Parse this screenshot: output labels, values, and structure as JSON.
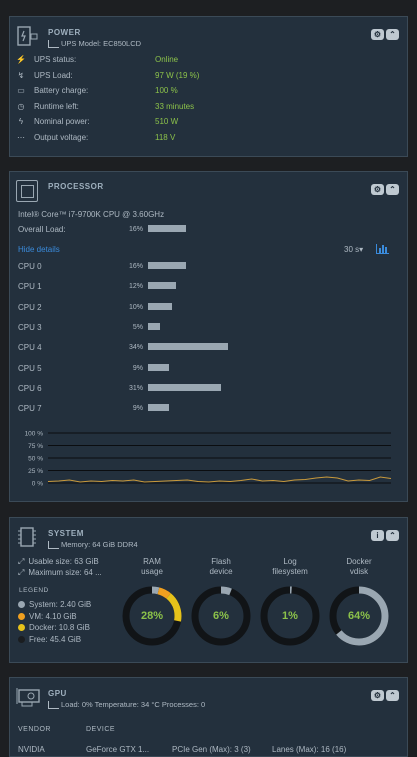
{
  "colors": {
    "bg": "#1d1f22",
    "panel": "#23303d",
    "green": "#8cc24a",
    "link": "#3a8bdc",
    "bar": "#9aa7b2",
    "orange": "#f0a020",
    "yellow": "#e6c21a"
  },
  "power": {
    "title": "POWER",
    "model": "UPS Model: EC850LCD",
    "rows": [
      {
        "icon": "plug-icon",
        "label": "UPS status:",
        "value": "Online"
      },
      {
        "icon": "load-icon",
        "label": "UPS Load:",
        "value": "97 W (19 %)"
      },
      {
        "icon": "battery-icon",
        "label": "Battery charge:",
        "value": "100 %"
      },
      {
        "icon": "clock-icon",
        "label": "Runtime left:",
        "value": "33 minutes"
      },
      {
        "icon": "bolt-icon",
        "label": "Nominal power:",
        "value": "510 W"
      },
      {
        "icon": "dots-icon",
        "label": "Output voltage:",
        "value": "118 V"
      }
    ]
  },
  "processor": {
    "title": "PROCESSOR",
    "model": "Intel® Core™ i7-9700K CPU @ 3.60GHz",
    "overall_label": "Overall Load:",
    "overall_pct": "16%",
    "overall_value": 16,
    "hide_details": "Hide details",
    "interval": "30 s▾",
    "cores": [
      {
        "label": "CPU 0",
        "pct": "16%",
        "value": 16
      },
      {
        "label": "CPU 1",
        "pct": "12%",
        "value": 12
      },
      {
        "label": "CPU 2",
        "pct": "10%",
        "value": 10
      },
      {
        "label": "CPU 3",
        "pct": "5%",
        "value": 5
      },
      {
        "label": "CPU 4",
        "pct": "34%",
        "value": 34
      },
      {
        "label": "CPU 5",
        "pct": "9%",
        "value": 9
      },
      {
        "label": "CPU 6",
        "pct": "31%",
        "value": 31
      },
      {
        "label": "CPU 7",
        "pct": "9%",
        "value": 9
      }
    ],
    "graph_ticks": [
      "100 %",
      "75 %",
      "50 %",
      "25 %",
      "0 %"
    ]
  },
  "system": {
    "title": "SYSTEM",
    "memory": "Memory: 64 GiB DDR4",
    "usable": "Usable size: 63 GiB",
    "maximum": "Maximum size: 64 ...",
    "legend_title": "LEGEND",
    "legend": [
      {
        "label": "System: 2.40 GiB",
        "color": "#9aa7b2"
      },
      {
        "label": "VM: 4.10 GiB",
        "color": "#f0a020"
      },
      {
        "label": "Docker: 10.8 GiB",
        "color": "#e6c21a"
      },
      {
        "label": "Free: 45.4 GiB",
        "color": "#1a1d20"
      }
    ],
    "donuts": [
      {
        "label1": "RAM",
        "label2": "usage",
        "value": "28%",
        "pct": 28
      },
      {
        "label1": "Flash",
        "label2": "device",
        "value": "6%",
        "pct": 6
      },
      {
        "label1": "Log",
        "label2": "filesystem",
        "value": "1%",
        "pct": 1
      },
      {
        "label1": "Docker",
        "label2": "vdisk",
        "value": "64%",
        "pct": 64
      }
    ]
  },
  "gpu": {
    "title": "GPU",
    "stats": "Load: 0% Temperature: 34 °C Processes: 0",
    "col_vendor": "VENDOR",
    "col_device": "DEVICE",
    "vendor": "NVIDIA",
    "device": "GeForce GTX 1...",
    "pcie": "PCIe Gen (Max): 3 (3)",
    "lanes": "Lanes (Max): 16 (16)"
  }
}
